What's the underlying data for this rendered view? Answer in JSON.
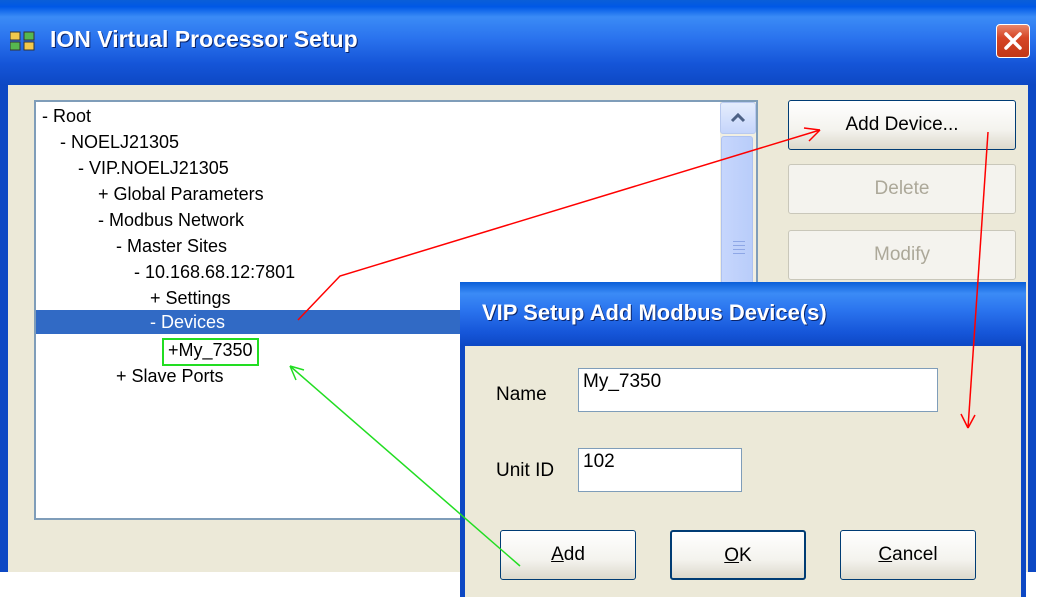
{
  "window": {
    "title": "ION Virtual Processor Setup",
    "close_icon": "close-icon"
  },
  "tree": {
    "items": [
      {
        "label": "- Root"
      },
      {
        "label": "- NOELJ21305"
      },
      {
        "label": "- VIP.NOELJ21305"
      },
      {
        "label": "+ Global Parameters"
      },
      {
        "label": "- Modbus Network"
      },
      {
        "label": "- Master Sites"
      },
      {
        "label": "- 10.168.68.12:7801"
      },
      {
        "label": "+ Settings"
      },
      {
        "label": "- Devices",
        "selected": true
      },
      {
        "label": "+My_7350",
        "highlighted": true
      },
      {
        "label": "+ Slave Ports"
      }
    ]
  },
  "buttons": {
    "add_device": "Add Device...",
    "delete": "Delete",
    "modify": "Modify"
  },
  "dialog": {
    "title": "VIP Setup Add Modbus Device(s)",
    "name_label": "Name",
    "name_value": "My_7350",
    "unit_id_label": "Unit ID",
    "unit_id_value": "102",
    "add_first": "A",
    "add_rest": "dd",
    "ok_first": "O",
    "ok_rest": "K",
    "cancel_first": "C",
    "cancel_rest": "ancel"
  },
  "colors": {
    "title_blue": "#0058e6",
    "selection": "#316ac5",
    "annotation_red": "#ff0000",
    "annotation_green": "#22dd22"
  }
}
